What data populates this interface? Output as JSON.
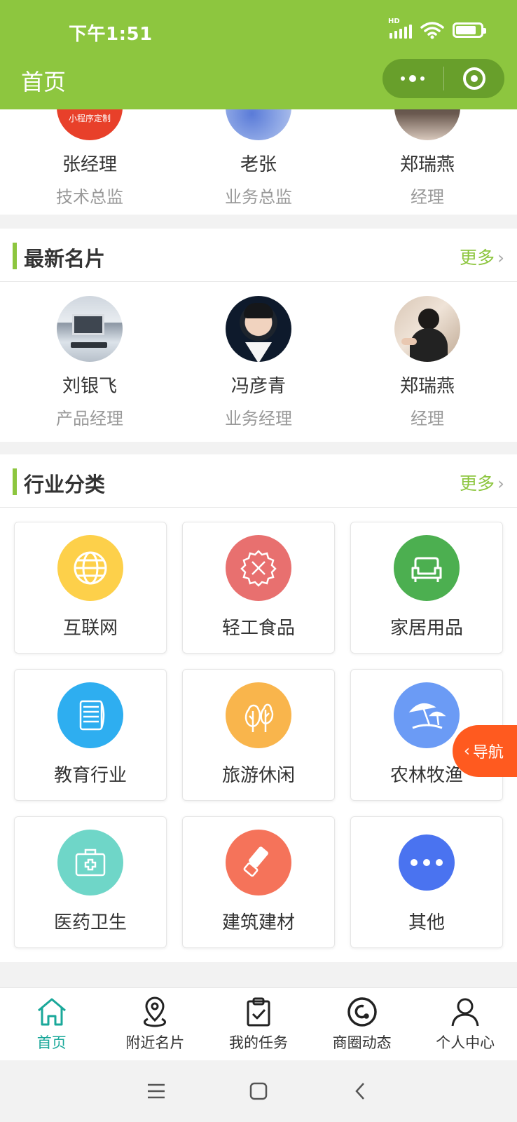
{
  "status_bar": {
    "time": "下午1:51",
    "network": "HD"
  },
  "nav": {
    "title": "首页"
  },
  "top_people": [
    {
      "name": "张经理",
      "title": "技术总监",
      "avatar_text": "小程序定制"
    },
    {
      "name": "老张",
      "title": "业务总监"
    },
    {
      "name": "郑瑞燕",
      "title": "经理"
    }
  ],
  "latest_cards": {
    "title": "最新名片",
    "more": "更多",
    "people": [
      {
        "name": "刘银飞",
        "title": "产品经理"
      },
      {
        "name": "冯彦青",
        "title": "业务经理"
      },
      {
        "name": "郑瑞燕",
        "title": "经理"
      }
    ]
  },
  "industry": {
    "title": "行业分类",
    "more": "更多",
    "categories": [
      {
        "label": "互联网",
        "icon": "globe-icon",
        "color": "#fdd04a"
      },
      {
        "label": "轻工食品",
        "icon": "fork-knife-icon",
        "color": "#e8706f"
      },
      {
        "label": "家居用品",
        "icon": "sofa-icon",
        "color": "#4caf50"
      },
      {
        "label": "教育行业",
        "icon": "book-icon",
        "color": "#2eaef0"
      },
      {
        "label": "旅游休闲",
        "icon": "tree-icon",
        "color": "#f9b54c"
      },
      {
        "label": "农林牧渔",
        "icon": "beach-umbrella-icon",
        "color": "#6b9bf5"
      },
      {
        "label": "医药卫生",
        "icon": "medical-kit-icon",
        "color": "#6fd6c8"
      },
      {
        "label": "建筑建材",
        "icon": "paint-roller-icon",
        "color": "#f5735a"
      },
      {
        "label": "其他",
        "icon": "more-dots-icon",
        "color": "#4a73f0"
      }
    ]
  },
  "float_nav": {
    "label": "导航"
  },
  "tabbar": {
    "items": [
      {
        "label": "首页",
        "icon": "home-icon",
        "active": true
      },
      {
        "label": "附近名片",
        "icon": "location-pin-icon"
      },
      {
        "label": "我的任务",
        "icon": "clipboard-check-icon"
      },
      {
        "label": "商圈动态",
        "icon": "circle-swirl-icon"
      },
      {
        "label": "个人中心",
        "icon": "user-icon"
      }
    ]
  },
  "colors": {
    "brand": "#8dc63f",
    "active_tab": "#1aa89a",
    "float_nav": "#ff5a1f"
  }
}
